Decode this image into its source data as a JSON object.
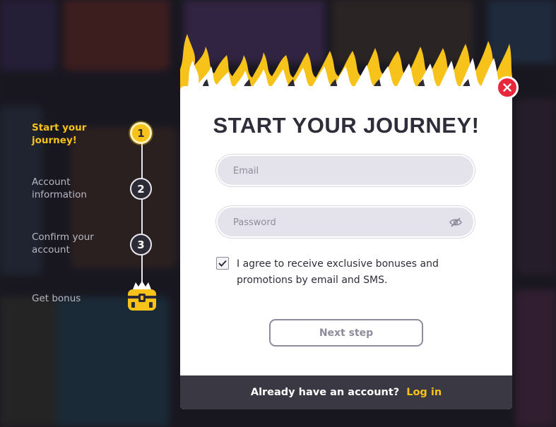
{
  "steps": [
    {
      "label_line1": "Start your",
      "label_line2": "journey!",
      "number": "1"
    },
    {
      "label_line1": "Account",
      "label_line2": "information",
      "number": "2"
    },
    {
      "label_line1": "Confirm your",
      "label_line2": "account",
      "number": "3"
    },
    {
      "label_line1": "Get bonus",
      "label_line2": "",
      "icon": "treasure-chest-icon"
    }
  ],
  "modal": {
    "title": "START YOUR JOURNEY!",
    "email_placeholder": "Email",
    "password_placeholder": "Password",
    "consent_text": "I agree to receive exclusive bonuses and promotions by email and SMS.",
    "consent_checked": true,
    "next_button": "Next step",
    "footer_question": "Already have an account?",
    "footer_link": "Log in"
  },
  "colors": {
    "accent": "#f7c21a",
    "close": "#e8273d",
    "footer_bg": "#3a3842",
    "title": "#2f2d3a"
  }
}
